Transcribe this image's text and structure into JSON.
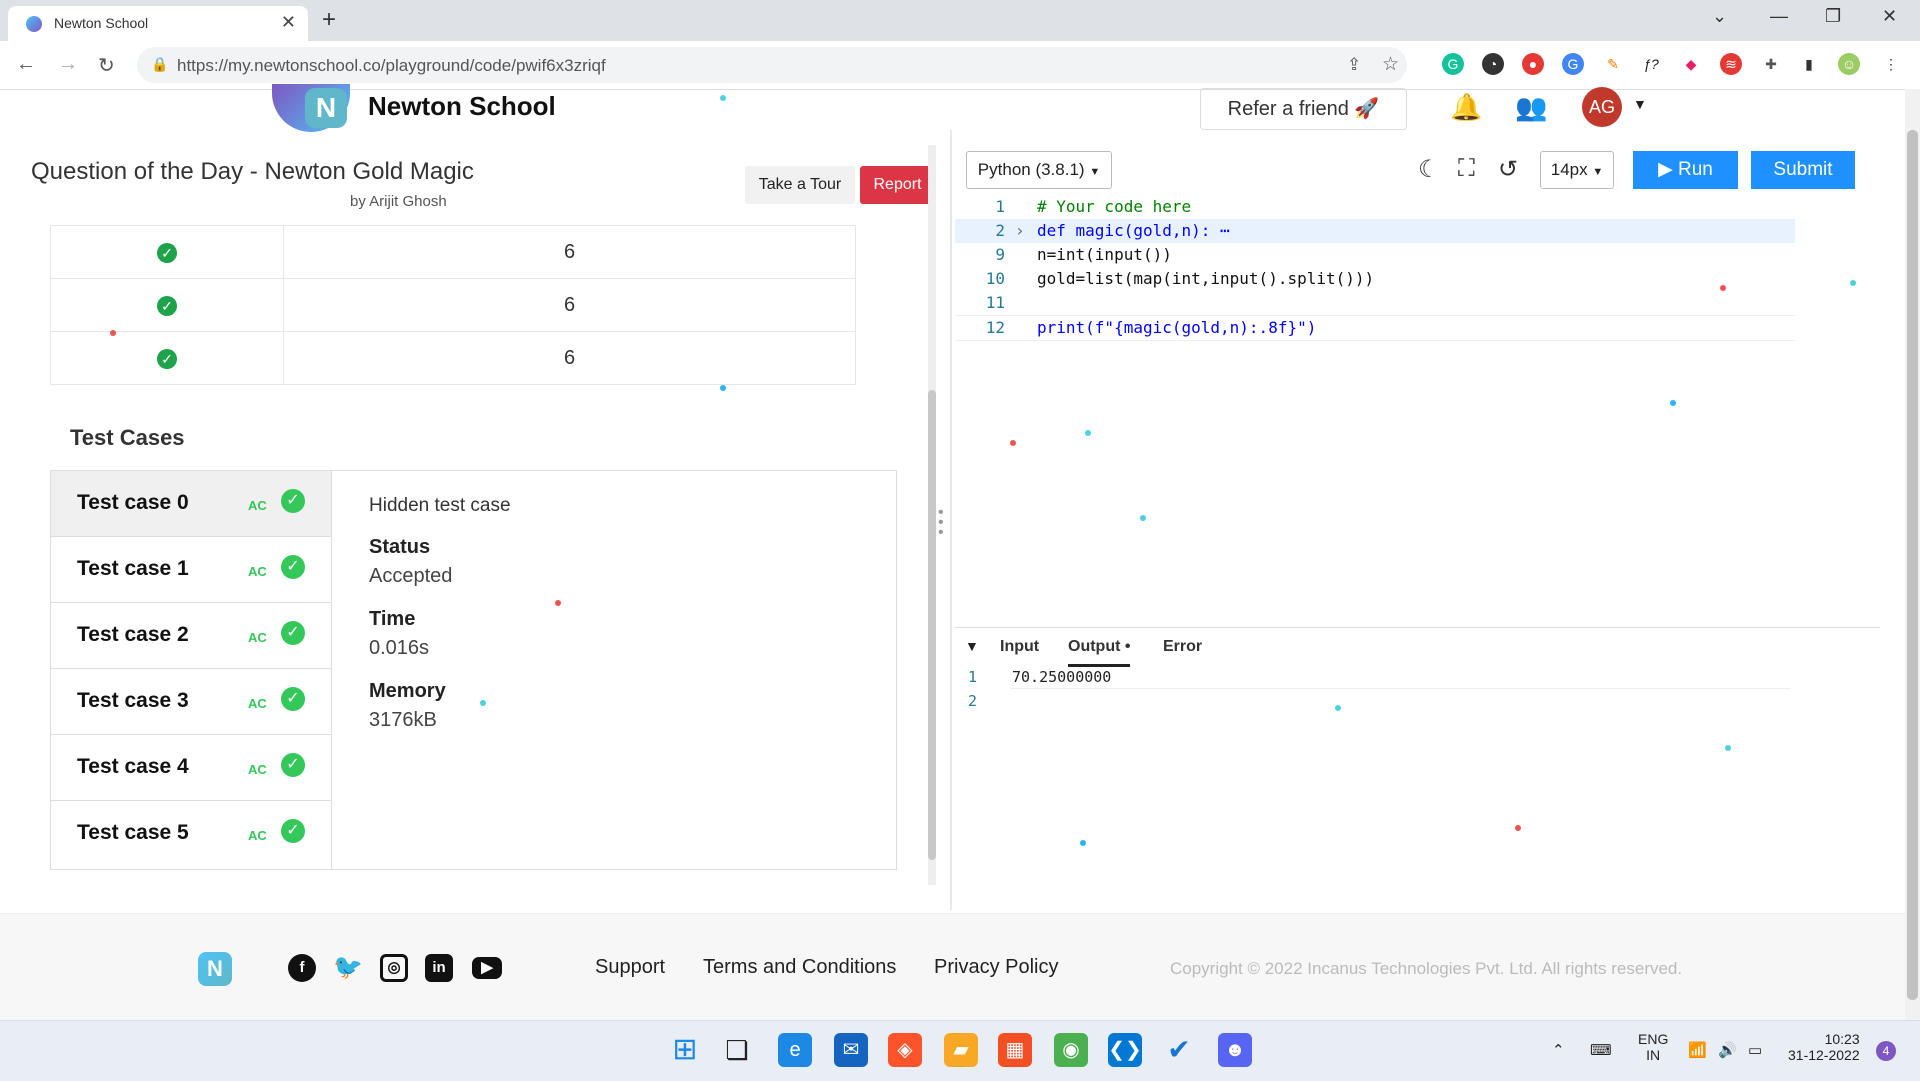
{
  "browser": {
    "tab_title": "Newton School",
    "url": "https://my.newtonschool.co/playground/code/pwif6x3zriqf"
  },
  "header": {
    "logo_text": "Newton School",
    "refer_label": "Refer a friend",
    "avatar_initials": "AG"
  },
  "question": {
    "title": "Question of the Day - Newton Gold Magic",
    "author": "by Arijit Ghosh",
    "tour_label": "Take a Tour",
    "report_label": "Report"
  },
  "prev_rows": [
    {
      "value": "6"
    },
    {
      "value": "6"
    },
    {
      "value": "6"
    }
  ],
  "test_cases": {
    "heading": "Test Cases",
    "items": [
      {
        "label": "Test case 0",
        "badge": "AC"
      },
      {
        "label": "Test case 1",
        "badge": "AC"
      },
      {
        "label": "Test case 2",
        "badge": "AC"
      },
      {
        "label": "Test case 3",
        "badge": "AC"
      },
      {
        "label": "Test case 4",
        "badge": "AC"
      },
      {
        "label": "Test case 5",
        "badge": "AC"
      }
    ],
    "detail": {
      "title": "Hidden test case",
      "status_label": "Status",
      "status_value": "Accepted",
      "time_label": "Time",
      "time_value": "0.016s",
      "memory_label": "Memory",
      "memory_value": "3176kB"
    }
  },
  "editor": {
    "language": "Python (3.8.1)",
    "font_size": "14px",
    "run_label": "Run",
    "submit_label": "Submit",
    "lines": [
      {
        "num": "1",
        "code": "# Your code here"
      },
      {
        "num": "2",
        "code": "def magic(gold,n): ⋯"
      },
      {
        "num": "9",
        "code": "n=int(input())"
      },
      {
        "num": "10",
        "code": "gold=list(map(int,input().split()))"
      },
      {
        "num": "11",
        "code": ""
      },
      {
        "num": "12",
        "code": "print(f\"{magic(gold,n):.8f}\")"
      }
    ]
  },
  "io": {
    "tabs": [
      "Input",
      "Output",
      "Error"
    ],
    "active_tab": "Output",
    "output_lines": [
      {
        "num": "1",
        "text": "70.25000000"
      },
      {
        "num": "2",
        "text": ""
      }
    ]
  },
  "footer": {
    "links": [
      "Support",
      "Terms and Conditions",
      "Privacy Policy"
    ],
    "copyright": "Copyright © 2022 Incanus Technologies Pvt. Ltd. All rights reserved."
  },
  "taskbar": {
    "lang_line1": "ENG",
    "lang_line2": "IN",
    "time": "10:23",
    "date": "31-12-2022",
    "notification_count": "4"
  },
  "colors": {
    "accent": "#1e90ff",
    "report": "#dc3545",
    "success": "#34c759",
    "avatar": "#c0392b"
  }
}
